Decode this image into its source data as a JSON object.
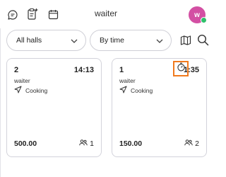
{
  "header": {
    "title": "waiter",
    "avatar_initial": "w",
    "icons": [
      "chat-bubble-icon",
      "clipboard-add-icon",
      "calendar-icon"
    ]
  },
  "filters": {
    "halls_value": "All halls",
    "sort_value": "By time",
    "map_icon": "map-icon",
    "search_icon": "search-icon"
  },
  "orders": [
    {
      "number": "2",
      "time": "14:13",
      "waiter": "waiter",
      "status": "Cooking",
      "amount": "500.00",
      "guests": "1"
    },
    {
      "number": "1",
      "time": "1:35",
      "waiter": "waiter",
      "status": "Cooking",
      "amount": "150.00",
      "guests": "2"
    }
  ],
  "colors": {
    "avatar": "#d34fa3",
    "online": "#2ec06a",
    "highlight": "#f07a1e",
    "border": "#d3d3db"
  }
}
